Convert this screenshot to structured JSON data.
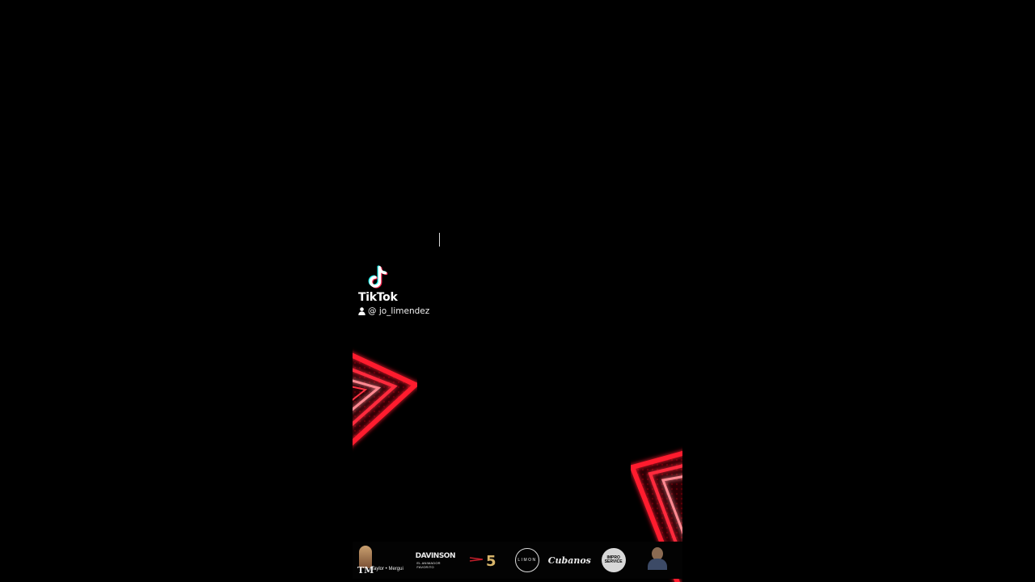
{
  "watermark": {
    "brand": "TikTok",
    "username": "@ jo_limendez"
  },
  "icons": {
    "tiktok": "tiktok-note-icon",
    "user": "user-icon"
  },
  "colors": {
    "background": "#000000",
    "neon": "#ff1a2e",
    "neon_glow": "#ff5a66",
    "tiktok_cyan": "#25f4ee",
    "tiktok_pink": "#fe2c55",
    "text": "#ffffff"
  },
  "sponsors": [
    {
      "id": "tm",
      "mark": "TM",
      "name": "Taylor • Mergui"
    },
    {
      "id": "davinson",
      "main": "DAVINSON",
      "sub": "EL ANIMADOR FAVORITO"
    },
    {
      "id": "five",
      "mark": "5"
    },
    {
      "id": "limon",
      "mark": "LIMON"
    },
    {
      "id": "cubanos",
      "mark": "Cubanos"
    },
    {
      "id": "badge",
      "mark": "IMPRO SERVICE"
    },
    {
      "id": "portrait",
      "mark": ""
    }
  ]
}
